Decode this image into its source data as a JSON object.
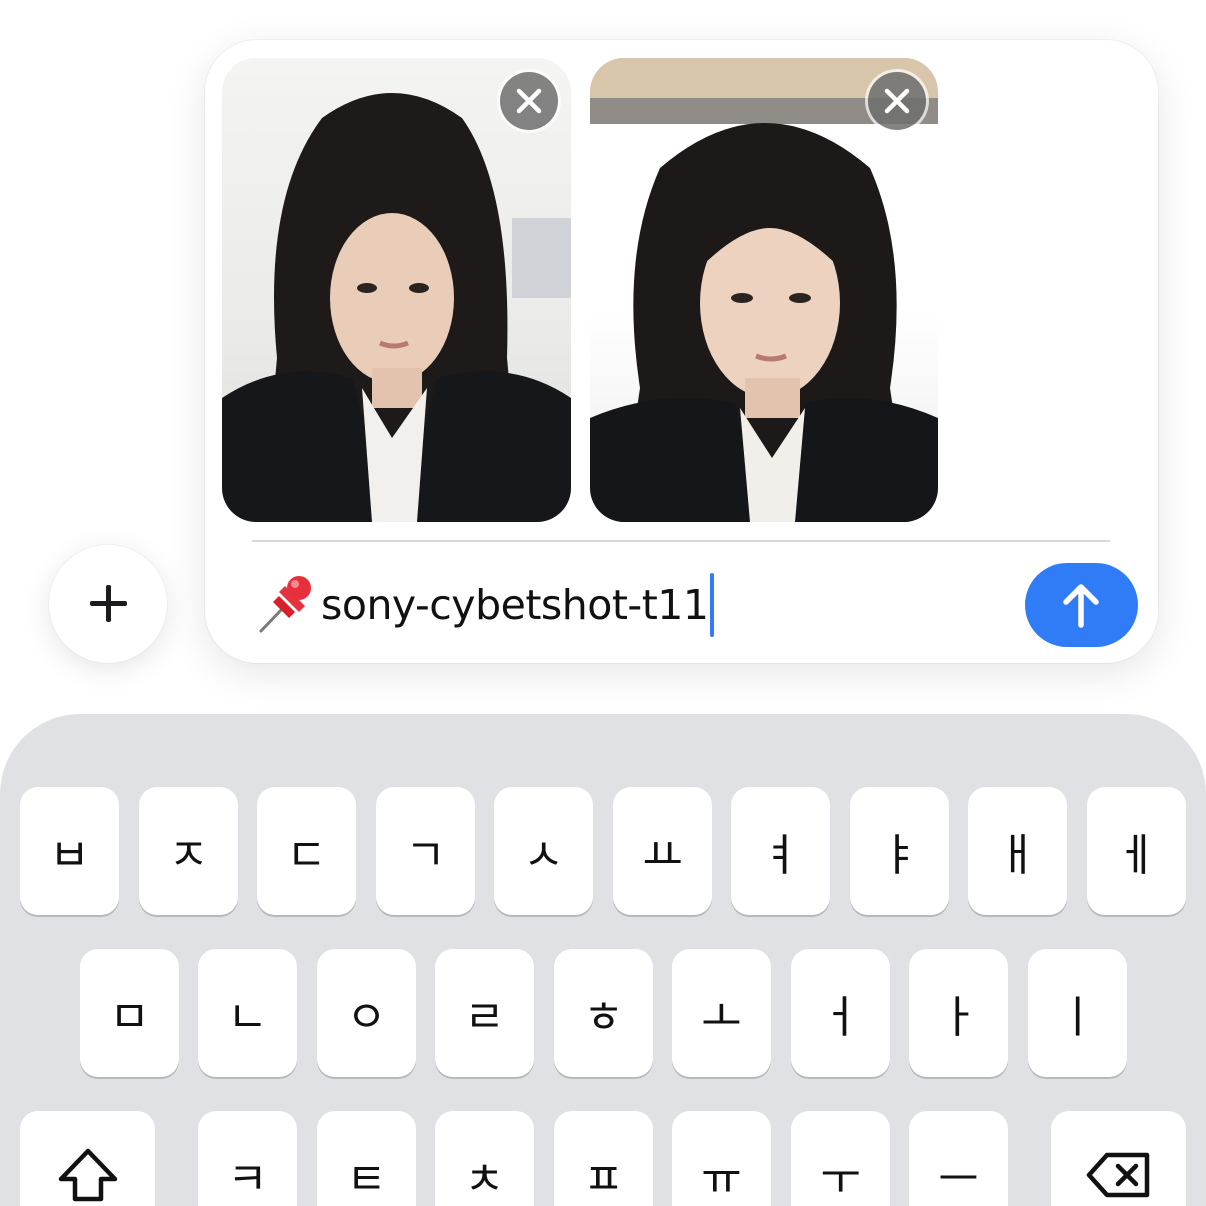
{
  "compose": {
    "attachments": [
      {
        "name": "photo-1",
        "remove_icon": "close-icon"
      },
      {
        "name": "photo-2",
        "remove_icon": "close-icon"
      }
    ],
    "message_emoji": "📌",
    "message_text": "sony-cybetshot-t11",
    "send_icon": "arrow-up-icon",
    "add_icon": "plus-icon"
  },
  "colors": {
    "accent": "#2f7cf6",
    "keyboard_bg": "#e0e1e5",
    "key_bg": "#ffffff"
  },
  "keyboard": {
    "row1": [
      "ㅂ",
      "ㅈ",
      "ㄷ",
      "ㄱ",
      "ㅅ",
      "ㅛ",
      "ㅕ",
      "ㅑ",
      "ㅐ",
      "ㅔ"
    ],
    "row2": [
      "ㅁ",
      "ㄴ",
      "ㅇ",
      "ㄹ",
      "ㅎ",
      "ㅗ",
      "ㅓ",
      "ㅏ",
      "ㅣ"
    ],
    "row3": [
      "ㅋ",
      "ㅌ",
      "ㅊ",
      "ㅍ",
      "ㅠ",
      "ㅜ",
      "ㅡ"
    ],
    "shift_icon": "shift-icon",
    "delete_icon": "backspace-icon"
  }
}
